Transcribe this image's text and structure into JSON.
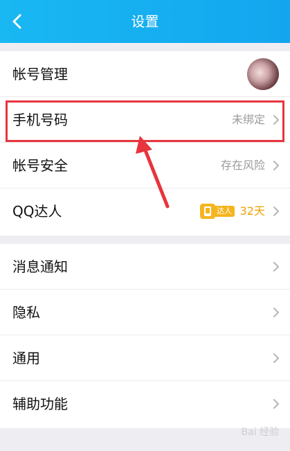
{
  "header": {
    "title": "设置"
  },
  "group1": {
    "items": [
      {
        "label": "帐号管理"
      },
      {
        "label": "手机号码",
        "value": "未绑定"
      },
      {
        "label": "帐号安全",
        "value": "存在风险"
      },
      {
        "label": "QQ达人",
        "badge_text": "达人",
        "days": "32天"
      }
    ]
  },
  "group2": {
    "items": [
      {
        "label": "消息通知"
      },
      {
        "label": "隐私"
      },
      {
        "label": "通用"
      },
      {
        "label": "辅助功能"
      }
    ]
  },
  "watermark": {
    "text": "Bai 经验"
  },
  "colors": {
    "header": "#13a6ef",
    "highlight": "#e8343d",
    "accent": "#f0a200"
  }
}
